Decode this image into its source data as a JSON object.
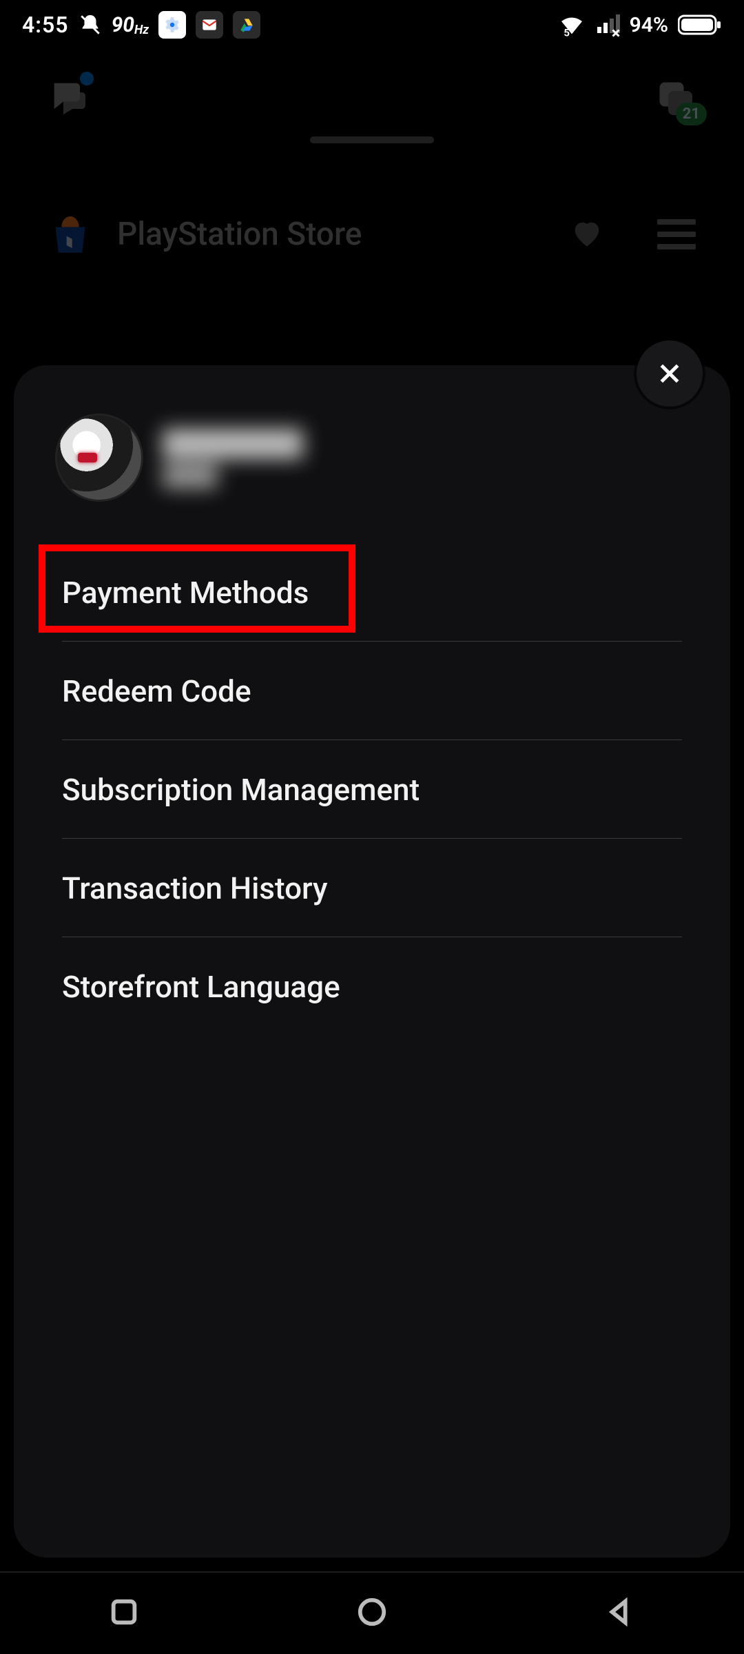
{
  "status_bar": {
    "time": "4:55",
    "refresh_rate": "90",
    "refresh_unit": "Hz",
    "battery_pct": "94%"
  },
  "background": {
    "store_title": "PlayStation Store",
    "dice_badge": "21"
  },
  "sheet": {
    "profile": {
      "name": "████████",
      "sub": "████"
    },
    "menu": [
      {
        "label": "Payment Methods"
      },
      {
        "label": "Redeem Code"
      },
      {
        "label": "Subscription Management"
      },
      {
        "label": "Transaction History"
      },
      {
        "label": "Storefront Language"
      }
    ]
  },
  "highlight": {
    "target_menu_index": 0
  }
}
